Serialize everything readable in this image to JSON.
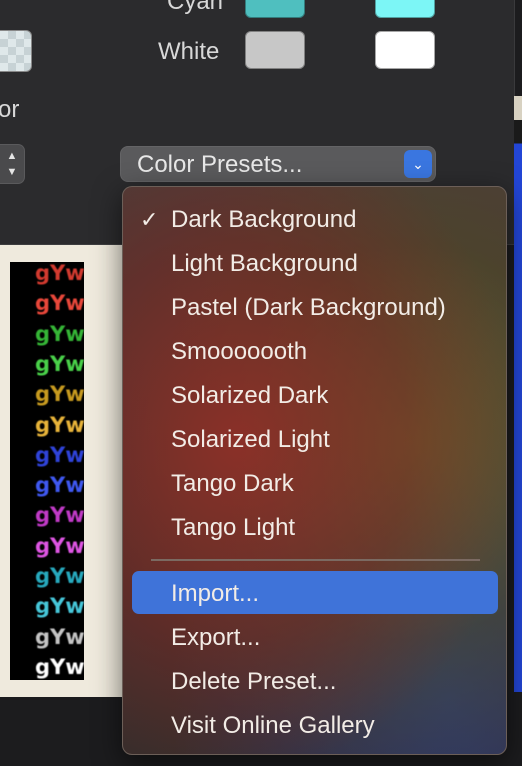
{
  "colors": {
    "cyan_normal": "#4fbfbf",
    "cyan_bright": "#7cf6f6",
    "white_normal": "#c7c7c7",
    "white_bright": "#ffffff",
    "menu_highlight": "#3f73d9",
    "chevron_button": "#3a76e0"
  },
  "pane": {
    "cyan_label": "Cyan",
    "white_label": "White",
    "cut_label": "or",
    "presets_button": "Color Presets...",
    "stepper_up_icon": "chevron-up-icon",
    "stepper_down_icon": "chevron-down-icon",
    "presets_icon": "chevron-down-icon"
  },
  "preview": {
    "rows": [
      {
        "text": "gYw",
        "color": "#d23a2f"
      },
      {
        "text": "gYw",
        "color": "#e8473a"
      },
      {
        "text": "gYw",
        "color": "#35b536"
      },
      {
        "text": "gYw",
        "color": "#49d049"
      },
      {
        "text": "gYw",
        "color": "#c79a1f"
      },
      {
        "text": "gYw",
        "color": "#e7b339"
      },
      {
        "text": "gYw",
        "color": "#2f43d8"
      },
      {
        "text": "gYw",
        "color": "#3f58f0"
      },
      {
        "text": "gYw",
        "color": "#c03ac6"
      },
      {
        "text": "gYw",
        "color": "#de55e3"
      },
      {
        "text": "gYw",
        "color": "#27a9bd"
      },
      {
        "text": "gYw",
        "color": "#46c6d8"
      },
      {
        "text": "gYw",
        "color": "#c4c4c4"
      },
      {
        "text": "gYw",
        "color": "#ffffff"
      }
    ]
  },
  "menu": {
    "checkmark": "✓",
    "items": [
      {
        "label": "Dark Background",
        "checked": true
      },
      {
        "label": "Light Background"
      },
      {
        "label": "Pastel (Dark Background)"
      },
      {
        "label": "Smooooooth"
      },
      {
        "label": "Solarized Dark"
      },
      {
        "label": "Solarized Light"
      },
      {
        "label": "Tango Dark"
      },
      {
        "label": "Tango Light"
      }
    ],
    "actions": [
      {
        "label": "Import...",
        "highlighted": true
      },
      {
        "label": "Export..."
      },
      {
        "label": "Delete Preset..."
      },
      {
        "label": "Visit Online Gallery"
      }
    ]
  }
}
